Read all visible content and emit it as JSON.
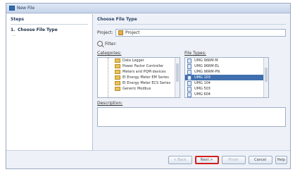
{
  "window": {
    "title": "New File"
  },
  "steps": {
    "heading": "Steps",
    "items": [
      {
        "num": "1.",
        "label": "Choose File Type"
      }
    ],
    "more": "..."
  },
  "main": {
    "heading": "Choose File Type",
    "project_label": "Project:",
    "project_value": "Project",
    "filter_label": "Filter:",
    "categories_label": "Categories:",
    "file_types_label": "File Types:",
    "description_label": "Description:",
    "categories": [
      "Data Logger",
      "Power Factor Controller",
      "Meters and PQM devices",
      "EI Energy Meter EM Series",
      "EI Energy Meter ECS Series",
      "Generic Modbus"
    ],
    "file_types": [
      "UMG 96RM-M",
      "UMG 96RM-EL",
      "UMG 96RM-PN",
      "UMG 103",
      "UMG 104",
      "UMG 503",
      "UMG 604"
    ],
    "selected_file_type_index": 3
  },
  "footer": {
    "back": "< Back",
    "next": "Next >",
    "finish": "Finish",
    "cancel": "Cancel",
    "help": "Help"
  }
}
